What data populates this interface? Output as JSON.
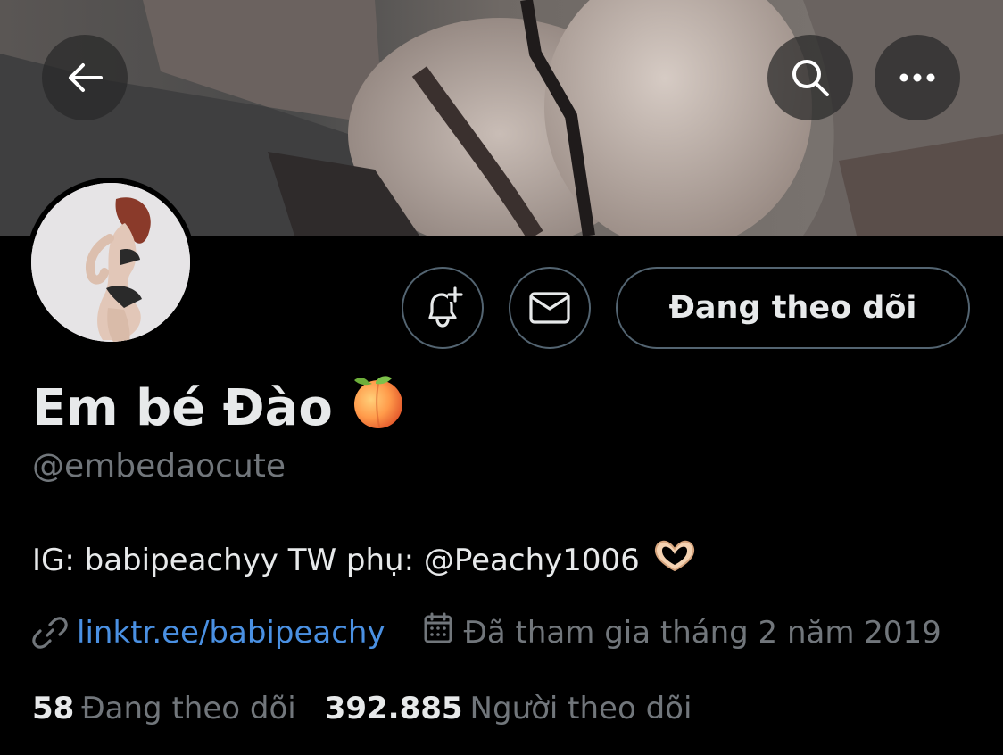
{
  "profile": {
    "display_name": "Em bé Đào",
    "handle": "@embedaocute",
    "bio": "IG: babipeachyy TW phụ: @Peachy1006",
    "website": "linktr.ee/babipeachy",
    "joined": "Đã tham gia tháng 2 năm 2019"
  },
  "actions": {
    "following_label": "Đang theo dõi"
  },
  "stats": {
    "following_count": "58",
    "following_label": "Đang theo dõi",
    "followers_count": "392.885",
    "followers_label": "Người theo dõi"
  },
  "icons": {
    "back": "arrow-left-icon",
    "search": "search-icon",
    "more": "more-dots-icon",
    "notify": "bell-plus-icon",
    "message": "envelope-icon",
    "link": "link-icon",
    "calendar": "calendar-icon",
    "peach": "peach-emoji",
    "heart_hands": "heart-hands-emoji"
  },
  "colors": {
    "background": "#000000",
    "text_primary": "#e7e9ea",
    "text_secondary": "#71767b",
    "link": "#4a90e2",
    "border": "#536471"
  }
}
